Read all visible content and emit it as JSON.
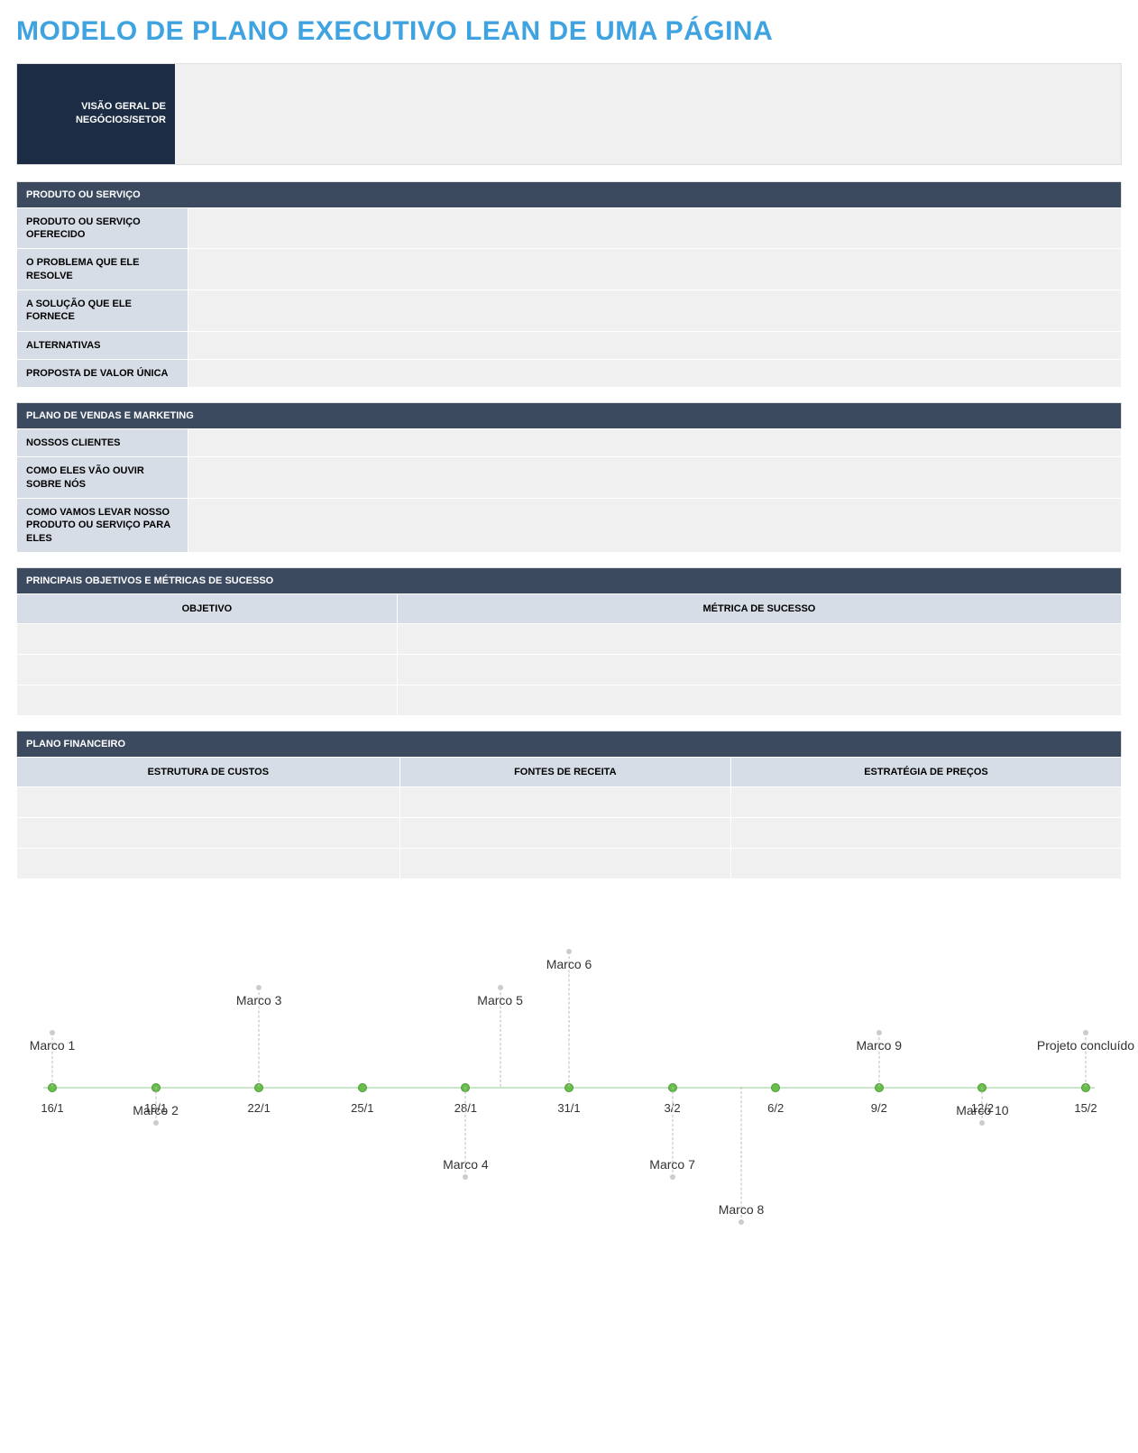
{
  "title": "MODELO DE PLANO EXECUTIVO LEAN DE UMA PÁGINA",
  "overview": {
    "label": "VISÃO GERAL DE NEGÓCIOS/SETOR",
    "value": ""
  },
  "product": {
    "header": "PRODUTO OU SERVIÇO",
    "rows": [
      {
        "label": "PRODUTO OU SERVIÇO OFERECIDO",
        "value": ""
      },
      {
        "label": "O PROBLEMA QUE ELE RESOLVE",
        "value": ""
      },
      {
        "label": "A SOLUÇÃO QUE ELE FORNECE",
        "value": ""
      },
      {
        "label": "ALTERNATIVAS",
        "value": ""
      },
      {
        "label": "PROPOSTA DE VALOR ÚNICA",
        "value": ""
      }
    ]
  },
  "sales": {
    "header": "PLANO DE VENDAS E MARKETING",
    "rows": [
      {
        "label": "NOSSOS CLIENTES",
        "value": ""
      },
      {
        "label": "COMO ELES VÃO OUVIR SOBRE NÓS",
        "value": ""
      },
      {
        "label": "COMO VAMOS LEVAR NOSSO PRODUTO OU SERVIÇO PARA ELES",
        "value": ""
      }
    ]
  },
  "objectives": {
    "header": "PRINCIPAIS OBJETIVOS E MÉTRICAS DE SUCESSO",
    "columns": [
      "OBJETIVO",
      "MÉTRICA DE SUCESSO"
    ],
    "rows": [
      [
        "",
        ""
      ],
      [
        "",
        ""
      ],
      [
        "",
        ""
      ]
    ]
  },
  "financial": {
    "header": "PLANO FINANCEIRO",
    "columns": [
      "ESTRUTURA DE CUSTOS",
      "FONTES DE RECEITA",
      "ESTRATÉGIA DE PREÇOS"
    ],
    "rows": [
      [
        "",
        "",
        ""
      ],
      [
        "",
        "",
        ""
      ],
      [
        "",
        "",
        ""
      ]
    ]
  },
  "chart_data": {
    "type": "timeline",
    "x_ticks": [
      "16/1",
      "19/1",
      "22/1",
      "25/1",
      "28/1",
      "31/1",
      "3/2",
      "6/2",
      "9/2",
      "12/2",
      "15/2"
    ],
    "milestones": [
      {
        "label": "Marco 1",
        "x": "16/1",
        "side": "up",
        "offset": 60
      },
      {
        "label": "Marco 2",
        "x": "19/1",
        "side": "down",
        "offset": 40
      },
      {
        "label": "Marco 3",
        "x": "22/1",
        "side": "up",
        "offset": 110
      },
      {
        "label": "Marco 4",
        "x": "28/1",
        "side": "down",
        "offset": 100
      },
      {
        "label": "Marco 5",
        "x": "29/1",
        "side": "up",
        "offset": 110
      },
      {
        "label": "Marco 6",
        "x": "31/1",
        "side": "up",
        "offset": 150
      },
      {
        "label": "Marco 7",
        "x": "3/2",
        "side": "down",
        "offset": 100
      },
      {
        "label": "Marco 8",
        "x": "5/2",
        "side": "down",
        "offset": 150
      },
      {
        "label": "Marco 9",
        "x": "9/2",
        "side": "up",
        "offset": 60
      },
      {
        "label": "Marco 10",
        "x": "12/2",
        "side": "down",
        "offset": 40
      },
      {
        "label": "Projeto concluído",
        "x": "15/2",
        "side": "up",
        "offset": 60
      }
    ]
  }
}
